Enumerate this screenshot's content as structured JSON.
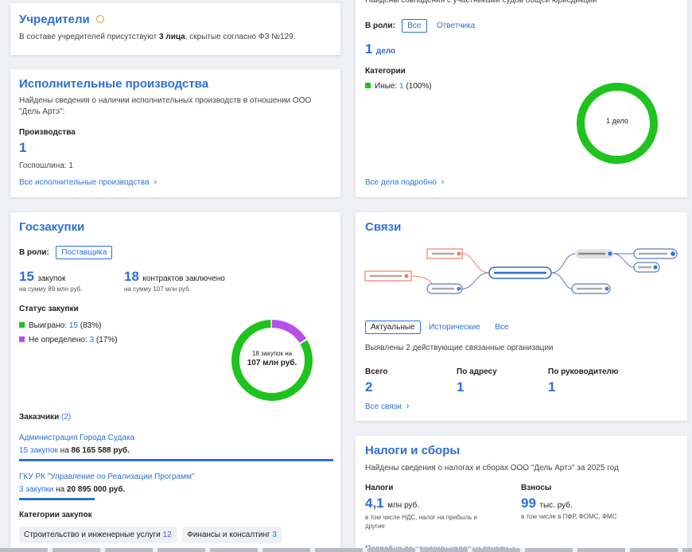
{
  "founders": {
    "title": "Учредители",
    "text_prefix": "В составе учредителей присутствуют",
    "count": "3 лица",
    "text_suffix": ", скрытые согласно ФЗ №129."
  },
  "enforcement": {
    "title": "Исполнительные производства",
    "desc": "Найдены сведения о наличии исполнительных производств в отношении ООО \"Дель Артэ\":",
    "label": "Производства",
    "count": "1",
    "fee": "Госпошлина: 1",
    "link": "Все исполнительные производства"
  },
  "courts": {
    "header_text": "Найдены совпадения с участниками судов общей юрисдикции",
    "role_label": "В роли:",
    "role_all": "Все",
    "role_defendant": "Ответчика",
    "cases_num": "1",
    "cases_unit": "дело",
    "categories_label": "Категории",
    "category_name": "Иные:",
    "category_value": "1",
    "category_pct": "(100%)",
    "donut_label": "1 дело",
    "link": "Все дела подробно",
    "color": "#1ec31e"
  },
  "procurement": {
    "title": "Госзакупки",
    "role_label": "В роли:",
    "role_value": "Поставщика",
    "purchases_num": "15",
    "purchases_text": "закупок",
    "purchases_sub": "на сумму 89 млн руб.",
    "contracts_num": "18",
    "contracts_text": "контрактов заключено",
    "contracts_sub": "на сумму 107 млн руб.",
    "status_label": "Статус закупки",
    "won_label": "Выиграно:",
    "won_value": "15",
    "won_pct": "(83%)",
    "undef_label": "Не определено:",
    "undef_value": "3",
    "undef_pct": "(17%)",
    "donut_line1": "18 закупок на",
    "donut_line2": "107 млн руб.",
    "customers_label": "Заказчики",
    "customers_count": "(2)",
    "customers": [
      {
        "name": "Администрация Города Судака",
        "link": "15 закупок",
        "mid": " на ",
        "amount": "86 165 588 руб.",
        "share": 1.0
      },
      {
        "name": "ГКУ РК \"Управление по Реализации Программ\"",
        "link": "3 закупки",
        "mid": " на ",
        "amount": "20 895 000 руб.",
        "share": 0.24
      }
    ],
    "categories_label": "Категории закупок",
    "chips": [
      {
        "label": "Строительство и инженерные услуги",
        "count": "12"
      },
      {
        "label": "Финансы и консалтинг",
        "count": "3"
      }
    ],
    "colors": {
      "won": "#1ec31e",
      "undef": "#b84fe8"
    }
  },
  "links": {
    "title": "Связи",
    "tab_current": "Актуальные",
    "tab_history": "Исторические",
    "tab_all": "Все",
    "summary": "Выявлены 2 действующие связанные организации",
    "total_label": "Всего",
    "total_value": "2",
    "address_label": "По адресу",
    "address_value": "1",
    "manager_label": "По руководителю",
    "manager_value": "1",
    "link": "Все связи"
  },
  "taxes": {
    "title": "Налоги и сборы",
    "desc": "Найдены сведения о налогах и сборах ООО \"Дель Артэ\" за 2025 год",
    "taxes_label": "Налоги",
    "taxes_num": "4,1",
    "taxes_unit": "млн руб.",
    "taxes_sub": "в том числе НДС, налог на прибыль и другие",
    "contrib_label": "Взносы",
    "contrib_num": "99",
    "contrib_unit": "тыс. руб.",
    "contrib_sub": "в том числе в ПФР, ФОМС, ФМС",
    "link": "Подробно по каждому налогу и взносу"
  }
}
